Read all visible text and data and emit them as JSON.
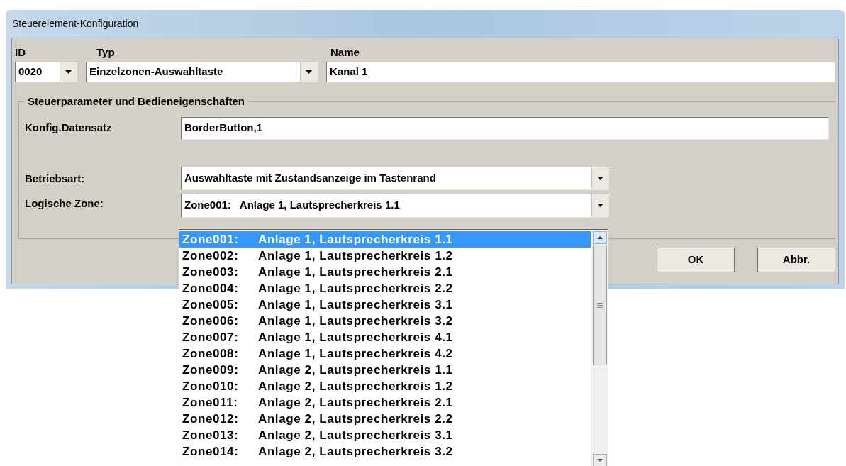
{
  "window": {
    "title": "Steuerelement-Konfiguration"
  },
  "header": {
    "id_label": "ID",
    "type_label": "Typ",
    "name_label": "Name",
    "id_value": "0020",
    "type_value": "Einzelzonen-Auswahltaste",
    "name_value": "Kanal 1"
  },
  "group": {
    "title": "Steuerparameter und Bedieneigenschaften",
    "config_label": "Konfig.Datensatz",
    "config_value": "BorderButton,1",
    "mode_label": "Betriebsart:",
    "mode_value": "Auswahltaste mit Zustandsanzeige im Tastenrand",
    "zone_label": "Logische Zone:",
    "zone_code": "Zone001:",
    "zone_value": "Anlage 1, Lautsprecherkreis 1.1"
  },
  "buttons": [
    {
      "label": "OK"
    },
    {
      "label": "Abbr."
    }
  ],
  "zone_list": {
    "expanded": true,
    "items": [
      {
        "code": "Zone001:",
        "label": "Anlage 1, Lautsprecherkreis 1.1",
        "selected": true
      },
      {
        "code": "Zone002:",
        "label": "Anlage 1, Lautsprecherkreis 1.2",
        "selected": false
      },
      {
        "code": "Zone003:",
        "label": "Anlage 1, Lautsprecherkreis 2.1",
        "selected": false
      },
      {
        "code": "Zone004:",
        "label": "Anlage 1, Lautsprecherkreis 2.2",
        "selected": false
      },
      {
        "code": "Zone005:",
        "label": "Anlage 1, Lautsprecherkreis 3.1",
        "selected": false
      },
      {
        "code": "Zone006:",
        "label": "Anlage 1, Lautsprecherkreis 3.2",
        "selected": false
      },
      {
        "code": "Zone007:",
        "label": "Anlage 1, Lautsprecherkreis 4.1",
        "selected": false
      },
      {
        "code": "Zone008:",
        "label": "Anlage 1, Lautsprecherkreis 4.2",
        "selected": false
      },
      {
        "code": "Zone009:",
        "label": "Anlage 2, Lautsprecherkreis 1.1",
        "selected": false
      },
      {
        "code": "Zone010:",
        "label": "Anlage 2, Lautsprecherkreis 1.2",
        "selected": false
      },
      {
        "code": "Zone011:",
        "label": "Anlage 2, Lautsprecherkreis 2.1",
        "selected": false
      },
      {
        "code": "Zone012:",
        "label": "Anlage 2, Lautsprecherkreis 2.2",
        "selected": false
      },
      {
        "code": "Zone013:",
        "label": "Anlage 2, Lautsprecherkreis 3.1",
        "selected": false
      },
      {
        "code": "Zone014:",
        "label": "Anlage 2, Lautsprecherkreis 3.2",
        "selected": false
      }
    ]
  }
}
